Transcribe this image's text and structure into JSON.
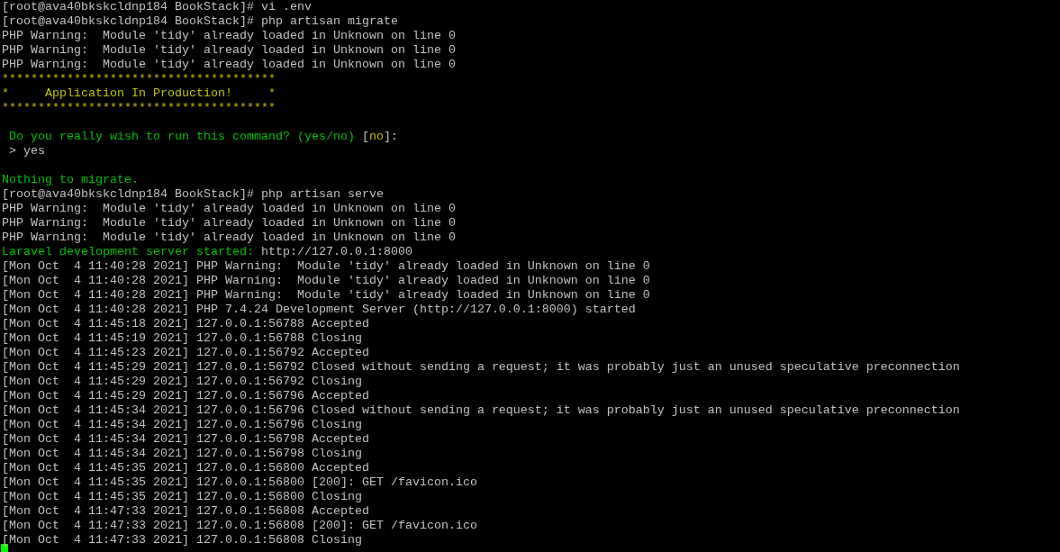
{
  "terminal": {
    "lines": [
      {
        "kind": "text",
        "segments": [
          {
            "text": "[root@ava40bkskcldnp184 BookStack]# vi .env",
            "kind": "normal"
          }
        ]
      },
      {
        "kind": "text",
        "segments": [
          {
            "text": "[root@ava40bkskcldnp184 BookStack]# php artisan migrate",
            "kind": "normal"
          }
        ]
      },
      {
        "kind": "text",
        "segments": [
          {
            "text": "PHP Warning:  Module 'tidy' already loaded in Unknown on line 0",
            "kind": "normal"
          }
        ]
      },
      {
        "kind": "text",
        "segments": [
          {
            "text": "PHP Warning:  Module 'tidy' already loaded in Unknown on line 0",
            "kind": "normal"
          }
        ]
      },
      {
        "kind": "text",
        "segments": [
          {
            "text": "PHP Warning:  Module 'tidy' already loaded in Unknown on line 0",
            "kind": "normal"
          }
        ]
      },
      {
        "kind": "text",
        "segments": [
          {
            "text": "**************************************",
            "kind": "highlight"
          }
        ]
      },
      {
        "kind": "text",
        "segments": [
          {
            "text": "*     Application In Production!     *",
            "kind": "highlight"
          }
        ]
      },
      {
        "kind": "text",
        "segments": [
          {
            "text": "**************************************",
            "kind": "highlight"
          }
        ]
      },
      {
        "kind": "blank"
      },
      {
        "kind": "text",
        "segments": [
          {
            "text": " Do you really wish to run this command? (yes/no) ",
            "kind": "success"
          },
          {
            "text": "[",
            "kind": "normal"
          },
          {
            "text": "no",
            "kind": "highlight"
          },
          {
            "text": "]:",
            "kind": "normal"
          }
        ]
      },
      {
        "kind": "text",
        "segments": [
          {
            "text": " > yes",
            "kind": "normal"
          }
        ]
      },
      {
        "kind": "blank"
      },
      {
        "kind": "text",
        "segments": [
          {
            "text": "Nothing to migrate.",
            "kind": "success"
          }
        ]
      },
      {
        "kind": "text",
        "segments": [
          {
            "text": "[root@ava40bkskcldnp184 BookStack]# php artisan serve",
            "kind": "normal"
          }
        ]
      },
      {
        "kind": "text",
        "segments": [
          {
            "text": "PHP Warning:  Module 'tidy' already loaded in Unknown on line 0",
            "kind": "normal"
          }
        ]
      },
      {
        "kind": "text",
        "segments": [
          {
            "text": "PHP Warning:  Module 'tidy' already loaded in Unknown on line 0",
            "kind": "normal"
          }
        ]
      },
      {
        "kind": "text",
        "segments": [
          {
            "text": "PHP Warning:  Module 'tidy' already loaded in Unknown on line 0",
            "kind": "normal"
          }
        ]
      },
      {
        "kind": "text",
        "segments": [
          {
            "text": "Laravel development server started: ",
            "kind": "success"
          },
          {
            "text": "http://127.0.0.1:8000",
            "kind": "normal"
          }
        ]
      },
      {
        "kind": "text",
        "segments": [
          {
            "text": "[Mon Oct  4 11:40:28 2021] PHP Warning:  Module 'tidy' already loaded in Unknown on line 0",
            "kind": "normal"
          }
        ]
      },
      {
        "kind": "text",
        "segments": [
          {
            "text": "[Mon Oct  4 11:40:28 2021] PHP Warning:  Module 'tidy' already loaded in Unknown on line 0",
            "kind": "normal"
          }
        ]
      },
      {
        "kind": "text",
        "segments": [
          {
            "text": "[Mon Oct  4 11:40:28 2021] PHP Warning:  Module 'tidy' already loaded in Unknown on line 0",
            "kind": "normal"
          }
        ]
      },
      {
        "kind": "text",
        "segments": [
          {
            "text": "[Mon Oct  4 11:40:28 2021] PHP 7.4.24 Development Server (http://127.0.0.1:8000) started",
            "kind": "normal"
          }
        ]
      },
      {
        "kind": "text",
        "segments": [
          {
            "text": "[Mon Oct  4 11:45:18 2021] 127.0.0.1:56788 Accepted",
            "kind": "normal"
          }
        ]
      },
      {
        "kind": "text",
        "segments": [
          {
            "text": "[Mon Oct  4 11:45:19 2021] 127.0.0.1:56788 Closing",
            "kind": "normal"
          }
        ]
      },
      {
        "kind": "text",
        "segments": [
          {
            "text": "[Mon Oct  4 11:45:23 2021] 127.0.0.1:56792 Accepted",
            "kind": "normal"
          }
        ]
      },
      {
        "kind": "text",
        "segments": [
          {
            "text": "[Mon Oct  4 11:45:29 2021] 127.0.0.1:56792 Closed without sending a request; it was probably just an unused speculative preconnection",
            "kind": "normal"
          }
        ]
      },
      {
        "kind": "text",
        "segments": [
          {
            "text": "[Mon Oct  4 11:45:29 2021] 127.0.0.1:56792 Closing",
            "kind": "normal"
          }
        ]
      },
      {
        "kind": "text",
        "segments": [
          {
            "text": "[Mon Oct  4 11:45:29 2021] 127.0.0.1:56796 Accepted",
            "kind": "normal"
          }
        ]
      },
      {
        "kind": "text",
        "segments": [
          {
            "text": "[Mon Oct  4 11:45:34 2021] 127.0.0.1:56796 Closed without sending a request; it was probably just an unused speculative preconnection",
            "kind": "normal"
          }
        ]
      },
      {
        "kind": "text",
        "segments": [
          {
            "text": "[Mon Oct  4 11:45:34 2021] 127.0.0.1:56796 Closing",
            "kind": "normal"
          }
        ]
      },
      {
        "kind": "text",
        "segments": [
          {
            "text": "[Mon Oct  4 11:45:34 2021] 127.0.0.1:56798 Accepted",
            "kind": "normal"
          }
        ]
      },
      {
        "kind": "text",
        "segments": [
          {
            "text": "[Mon Oct  4 11:45:34 2021] 127.0.0.1:56798 Closing",
            "kind": "normal"
          }
        ]
      },
      {
        "kind": "text",
        "segments": [
          {
            "text": "[Mon Oct  4 11:45:35 2021] 127.0.0.1:56800 Accepted",
            "kind": "normal"
          }
        ]
      },
      {
        "kind": "text",
        "segments": [
          {
            "text": "[Mon Oct  4 11:45:35 2021] 127.0.0.1:56800 [200]: GET /favicon.ico",
            "kind": "normal"
          }
        ]
      },
      {
        "kind": "text",
        "segments": [
          {
            "text": "[Mon Oct  4 11:45:35 2021] 127.0.0.1:56800 Closing",
            "kind": "normal"
          }
        ]
      },
      {
        "kind": "text",
        "segments": [
          {
            "text": "[Mon Oct  4 11:47:33 2021] 127.0.0.1:56808 Accepted",
            "kind": "normal"
          }
        ]
      },
      {
        "kind": "text",
        "segments": [
          {
            "text": "[Mon Oct  4 11:47:33 2021] 127.0.0.1:56808 [200]: GET /favicon.ico",
            "kind": "normal"
          }
        ]
      },
      {
        "kind": "text",
        "segments": [
          {
            "text": "[Mon Oct  4 11:47:33 2021] 127.0.0.1:56808 Closing",
            "kind": "normal"
          }
        ]
      }
    ],
    "cursor": {
      "visible": true
    }
  }
}
